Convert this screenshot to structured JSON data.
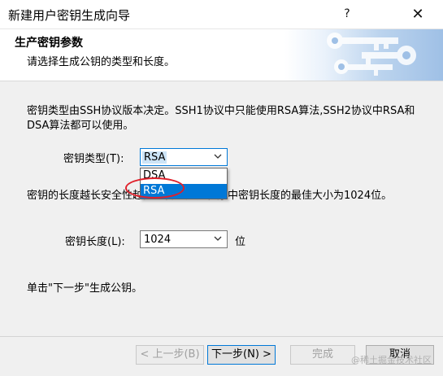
{
  "window": {
    "title": "新建用户密钥生成向导",
    "help": "?",
    "close": "✕"
  },
  "header": {
    "title": "生产密钥参数",
    "subtitle": "请选择生成公钥的类型和长度。"
  },
  "body": {
    "description1": "密钥类型由SSH协议版本决定。SSH1协议中只能使用RSA算法,SSH2协议中RSA和DSA算法都可以使用。",
    "key_type": {
      "label": "密钥类型(T):",
      "value": "RSA",
      "options": [
        "DSA",
        "RSA"
      ]
    },
    "description2": "密钥的长度越长安全性越高。普通应用程序中密钥长度的最佳大小为1024位。",
    "key_length": {
      "label": "密钥长度(L):",
      "value": "1024",
      "unit": "位"
    },
    "instruction": "单击\"下一步\"生成公钥。"
  },
  "footer": {
    "back": "< 上一步(B)",
    "next": "下一步(N) >",
    "finish": "完成",
    "cancel": "取消",
    "watermark": "@稀土掘金技术社区"
  },
  "icons": {
    "chevron": "chevron-down-icon",
    "close": "close-icon",
    "help": "help-icon",
    "keys": "keys-icon"
  },
  "colors": {
    "accent": "#0078d7",
    "highlight": "#cce4f7",
    "annotation": "#e0202a"
  }
}
